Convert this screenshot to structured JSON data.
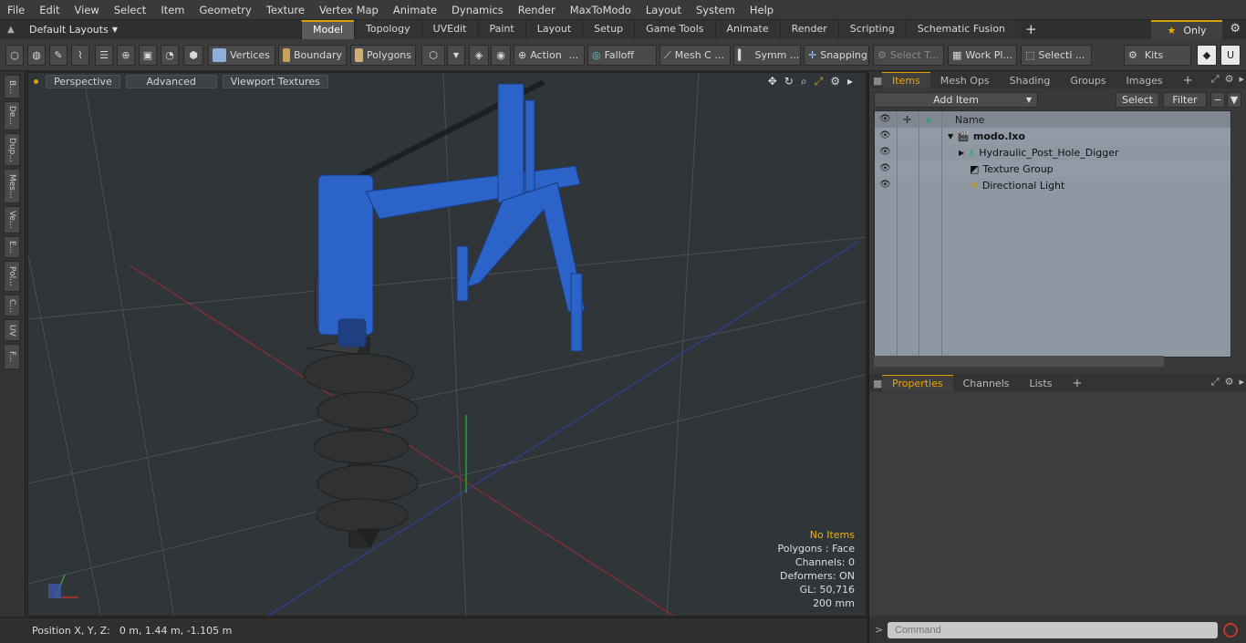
{
  "menu": [
    "File",
    "Edit",
    "View",
    "Select",
    "Item",
    "Geometry",
    "Texture",
    "Vertex Map",
    "Animate",
    "Dynamics",
    "Render",
    "MaxToModo",
    "Layout",
    "System",
    "Help"
  ],
  "layouts": {
    "label": "Default Layouts"
  },
  "tabs": [
    "Model",
    "Topology",
    "UVEdit",
    "Paint",
    "Layout",
    "Setup",
    "Game Tools",
    "Animate",
    "Render",
    "Scripting",
    "Schematic Fusion"
  ],
  "active_tab": "Model",
  "only_label": "Only",
  "toolbar": {
    "vertices": "Vertices",
    "boundary": "Boundary",
    "polygons": "Polygons",
    "action": "Action",
    "falloff": "Falloff",
    "mesh": "Mesh C ...",
    "symm": "Symm ...",
    "snapping": "Snapping",
    "select_t": "Select T...",
    "workpl": "Work Pl...",
    "selecti": "Selecti ...",
    "kits": "Kits",
    "action_dots": "..."
  },
  "left_tabs": [
    "B...",
    "De...",
    "Dup...",
    "Mes...",
    "Ve...",
    "E...",
    "Pol...",
    "C...",
    "UV",
    "F..."
  ],
  "viewport": {
    "buttons": [
      "Perspective",
      "Advanced",
      "Viewport Textures"
    ],
    "info": {
      "items": "No Items",
      "polygons": "Polygons : Face",
      "channels": "Channels: 0",
      "deformers": "Deformers: ON",
      "gl": "GL: 50,716",
      "scale": "200 mm"
    }
  },
  "status": {
    "label": "Position X, Y, Z:",
    "value": "0 m, 1.44 m, -1.105 m"
  },
  "items_panel": {
    "tabs": [
      "Items",
      "Mesh Ops",
      "Shading",
      "Groups",
      "Images"
    ],
    "add_item": "Add Item",
    "select": "Select",
    "filter": "Filter",
    "name_header": "Name",
    "rows": [
      {
        "name": "modo.lxo",
        "icon": "scene-icon"
      },
      {
        "name": "Hydraulic_Post_Hole_Digger",
        "icon": "mesh-item-icon"
      },
      {
        "name": "Texture Group",
        "icon": "texture-group-icon"
      },
      {
        "name": "Directional Light",
        "icon": "light-icon"
      }
    ]
  },
  "props_panel": {
    "tabs": [
      "Properties",
      "Channels",
      "Lists"
    ]
  },
  "command": {
    "placeholder": "Command"
  },
  "colors": {
    "accent": "#e0a000",
    "model_blue": "#2c63c9",
    "auger": "#2f3133"
  }
}
